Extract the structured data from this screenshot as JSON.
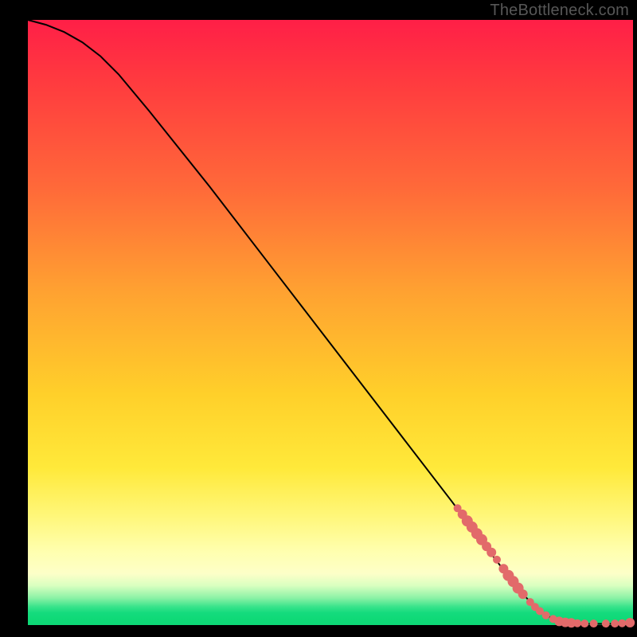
{
  "attribution": "TheBottleneck.com",
  "chart_data": {
    "type": "line",
    "title": "",
    "xlabel": "",
    "ylabel": "",
    "xlim": [
      0,
      100
    ],
    "ylim": [
      0,
      100
    ],
    "curve": [
      {
        "x": 0,
        "y": 100
      },
      {
        "x": 3,
        "y": 99.2
      },
      {
        "x": 6,
        "y": 98.0
      },
      {
        "x": 9,
        "y": 96.3
      },
      {
        "x": 12,
        "y": 94.0
      },
      {
        "x": 15,
        "y": 91.0
      },
      {
        "x": 20,
        "y": 85.0
      },
      {
        "x": 30,
        "y": 72.5
      },
      {
        "x": 40,
        "y": 59.5
      },
      {
        "x": 50,
        "y": 46.5
      },
      {
        "x": 60,
        "y": 33.5
      },
      {
        "x": 70,
        "y": 20.5
      },
      {
        "x": 76,
        "y": 12.5
      },
      {
        "x": 80,
        "y": 7.3
      },
      {
        "x": 83,
        "y": 3.8
      },
      {
        "x": 85,
        "y": 2.0
      },
      {
        "x": 87,
        "y": 0.9
      },
      {
        "x": 89,
        "y": 0.4
      },
      {
        "x": 92,
        "y": 0.2
      },
      {
        "x": 96,
        "y": 0.2
      },
      {
        "x": 100,
        "y": 0.3
      }
    ],
    "markers": [
      {
        "x": 71.0,
        "y": 19.3,
        "r": 5
      },
      {
        "x": 71.8,
        "y": 18.3,
        "r": 6
      },
      {
        "x": 72.6,
        "y": 17.2,
        "r": 7
      },
      {
        "x": 73.4,
        "y": 16.2,
        "r": 7
      },
      {
        "x": 74.2,
        "y": 15.1,
        "r": 7
      },
      {
        "x": 75.0,
        "y": 14.1,
        "r": 7
      },
      {
        "x": 75.8,
        "y": 13.0,
        "r": 6
      },
      {
        "x": 76.6,
        "y": 12.0,
        "r": 6
      },
      {
        "x": 77.5,
        "y": 10.8,
        "r": 5
      },
      {
        "x": 78.6,
        "y": 9.3,
        "r": 6
      },
      {
        "x": 79.4,
        "y": 8.2,
        "r": 7
      },
      {
        "x": 80.2,
        "y": 7.2,
        "r": 7
      },
      {
        "x": 81.0,
        "y": 6.1,
        "r": 7
      },
      {
        "x": 81.8,
        "y": 5.1,
        "r": 6
      },
      {
        "x": 83.0,
        "y": 3.8,
        "r": 5
      },
      {
        "x": 83.8,
        "y": 3.0,
        "r": 5
      },
      {
        "x": 84.6,
        "y": 2.3,
        "r": 5
      },
      {
        "x": 85.6,
        "y": 1.6,
        "r": 5
      },
      {
        "x": 86.8,
        "y": 1.0,
        "r": 5
      },
      {
        "x": 87.8,
        "y": 0.6,
        "r": 6
      },
      {
        "x": 88.8,
        "y": 0.45,
        "r": 6
      },
      {
        "x": 89.8,
        "y": 0.35,
        "r": 6
      },
      {
        "x": 90.8,
        "y": 0.3,
        "r": 5
      },
      {
        "x": 92.0,
        "y": 0.25,
        "r": 5
      },
      {
        "x": 93.5,
        "y": 0.25,
        "r": 5
      },
      {
        "x": 95.5,
        "y": 0.25,
        "r": 5
      },
      {
        "x": 97.0,
        "y": 0.25,
        "r": 5
      },
      {
        "x": 98.2,
        "y": 0.3,
        "r": 5
      },
      {
        "x": 99.5,
        "y": 0.4,
        "r": 6
      }
    ],
    "marker_color": "#e26a6a"
  }
}
